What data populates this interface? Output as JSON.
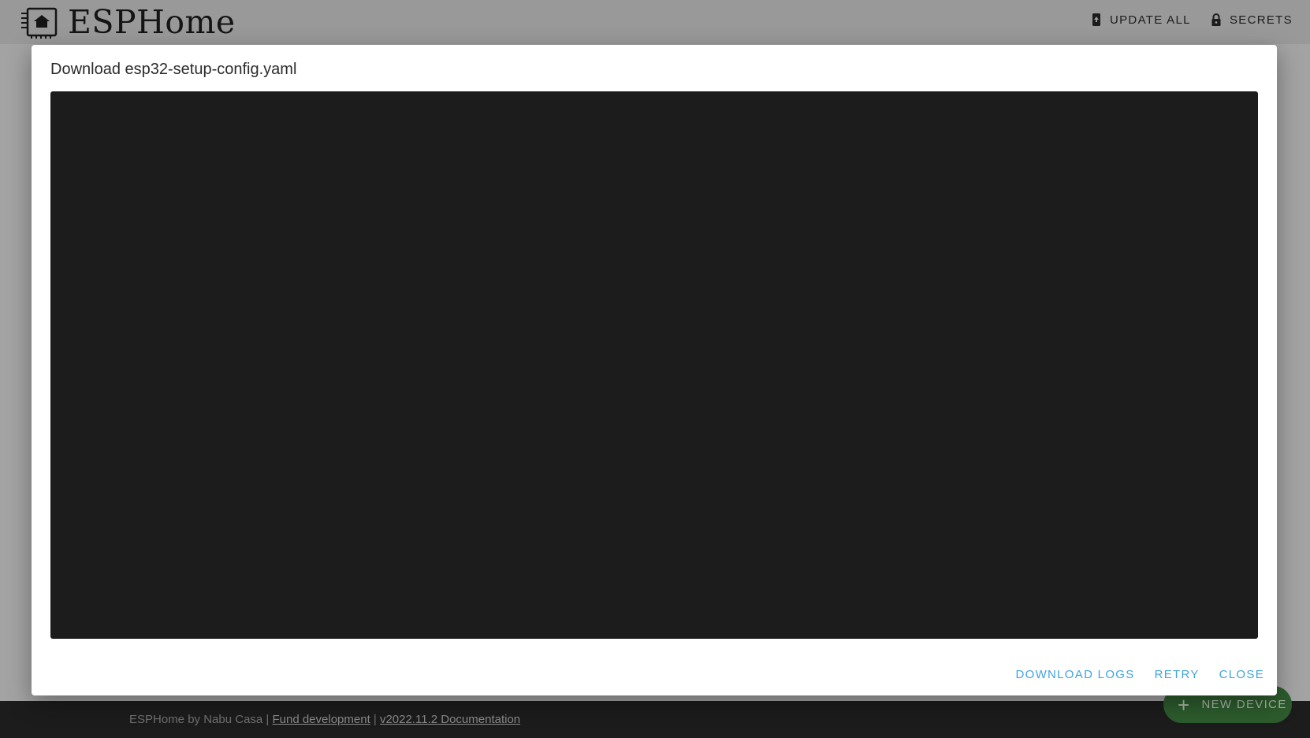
{
  "app": {
    "name": "ESPHome",
    "actions": {
      "update_all": {
        "label": "UPDATE ALL",
        "icon": "update-icon"
      },
      "secrets": {
        "label": "SECRETS",
        "icon": "lock-icon"
      }
    }
  },
  "dialog": {
    "title": "Download esp32-setup-config.yaml",
    "log_output": "",
    "buttons": {
      "download_logs": "DOWNLOAD LOGS",
      "retry": "RETRY",
      "close": "CLOSE"
    }
  },
  "footer": {
    "credit": "ESPHome by Nabu Casa",
    "separator": " | ",
    "fund_link": "Fund development",
    "version_link": "v2022.11.2 Documentation"
  },
  "fab": {
    "label": "NEW DEVICE",
    "icon": "plus-icon"
  },
  "colors": {
    "accent": "#3fa3e0",
    "terminal_bg": "#1c1c1c",
    "fab_bg": "#2d5c2d",
    "app_bar_bg": "#999999"
  }
}
